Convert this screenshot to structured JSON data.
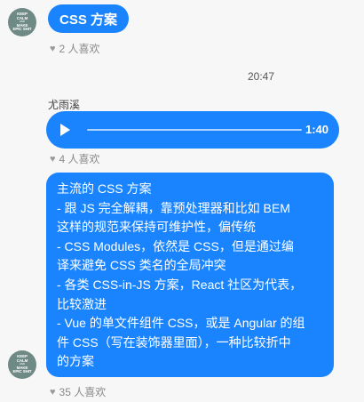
{
  "messages": [
    {
      "avatar_text": [
        "KEEP",
        "CALM",
        "AND",
        "MAKE",
        "EPIC SHIT"
      ],
      "text": "CSS 方案",
      "likes": "2 人喜欢"
    },
    {
      "time": "20:47",
      "author": "尤雨溪",
      "audio_duration": "1:40",
      "audio_progress": 0,
      "likes": "4 人喜欢"
    },
    {
      "avatar_text": [
        "KEEP",
        "CALM",
        "AND",
        "MAKE",
        "EPIC SHIT"
      ],
      "lines": [
        "主流的 CSS 方案",
        "- 跟 JS 完全解耦，靠预处理器和比如 BEM",
        "这样的规范来保持可维护性，偏传统",
        "- CSS Modules，依然是 CSS，但是通过编",
        "译来避免 CSS 类名的全局冲突",
        "- 各类 CSS-in-JS 方案，React 社区为代表，",
        "比较激进",
        "- Vue 的单文件组件 CSS，或是 Angular 的组",
        "件 CSS（写在装饰器里面），一种比较折中",
        "的方案"
      ],
      "likes": "35 人喜欢"
    }
  ],
  "colors": {
    "bubble": "#1a84ff",
    "background": "#f7f7f8"
  },
  "icons": {
    "like": "heart-icon",
    "play": "play-icon"
  }
}
